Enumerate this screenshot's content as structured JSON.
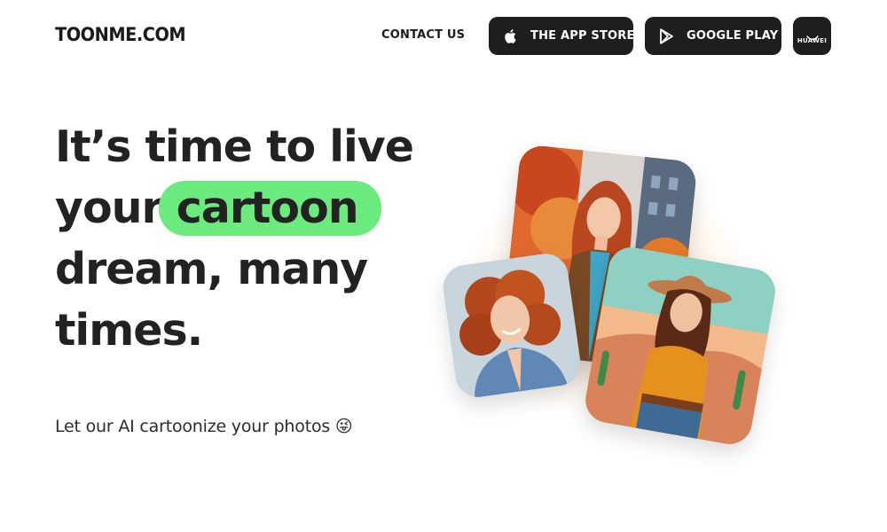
{
  "header": {
    "logo": "TOONME.COM",
    "nav": {
      "contact_label": "CONTACT US"
    },
    "stores": {
      "apple_label": "THE APP STORE",
      "google_label": "GOOGLE PLAY",
      "huawei_label": "HUAWEI"
    }
  },
  "hero": {
    "headline_line1": "It’s time to live",
    "headline_line2_prefix": "your ",
    "headline_highlight": "cartoon",
    "headline_line3": "dream, many",
    "headline_line4": "times.",
    "subtitle": "Let our AI cartoonize your photos 😜"
  },
  "colors": {
    "highlight": "#6bea7e",
    "button_bg": "#1e1e1e",
    "text": "#222222"
  },
  "icons": [
    "apple-icon",
    "google-play-icon",
    "huawei-bag-icon"
  ]
}
